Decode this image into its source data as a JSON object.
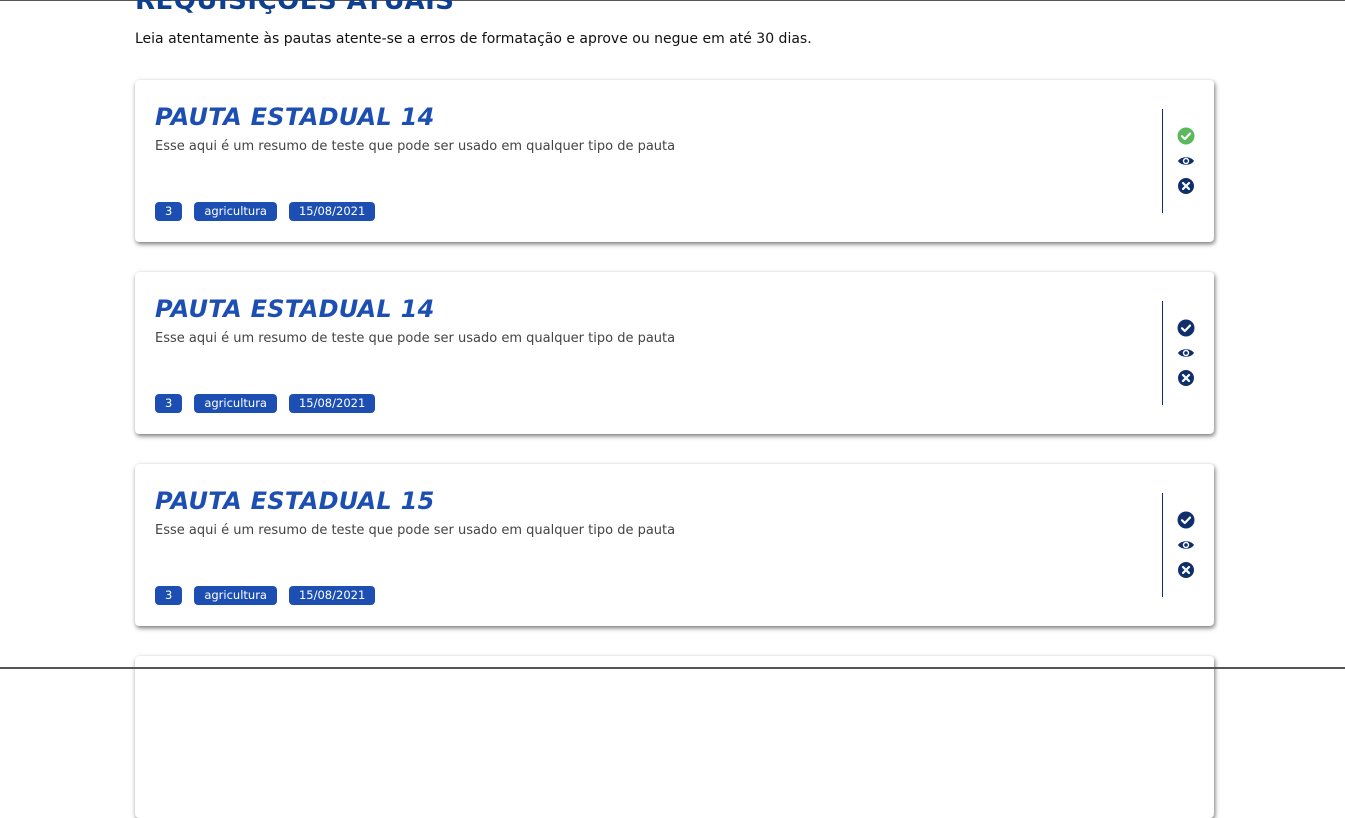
{
  "page": {
    "title": "REQUISIÇÕES ATUAIS",
    "subtitle": "Leia atentamente às pautas atente-se a erros de formatação e aprove ou negue em até 30 dias."
  },
  "colors": {
    "title": "#0f3f8f",
    "accent": "#1d4fb3",
    "approved": "#5cb85c",
    "action_dark": "#0f2f6b"
  },
  "cards": [
    {
      "title": "PAUTA ESTADUAL 14",
      "summary": "Esse aqui é um resumo de teste que pode ser usado em qualquer tipo de pauta",
      "tags": [
        "3",
        "agricultura",
        "15/08/2021"
      ],
      "approve_state": "approved",
      "actions": [
        "check-circle-icon",
        "eye-icon",
        "times-circle-icon"
      ]
    },
    {
      "title": "PAUTA ESTADUAL 14",
      "summary": "Esse aqui é um resumo de teste que pode ser usado em qualquer tipo de pauta",
      "tags": [
        "3",
        "agricultura",
        "15/08/2021"
      ],
      "approve_state": "pending",
      "actions": [
        "check-circle-icon",
        "eye-icon",
        "times-circle-icon"
      ]
    },
    {
      "title": "PAUTA ESTADUAL 15",
      "summary": "Esse aqui é um resumo de teste que pode ser usado em qualquer tipo de pauta",
      "tags": [
        "3",
        "agricultura",
        "15/08/2021"
      ],
      "approve_state": "pending",
      "actions": [
        "check-circle-icon",
        "eye-icon",
        "times-circle-icon"
      ]
    }
  ]
}
